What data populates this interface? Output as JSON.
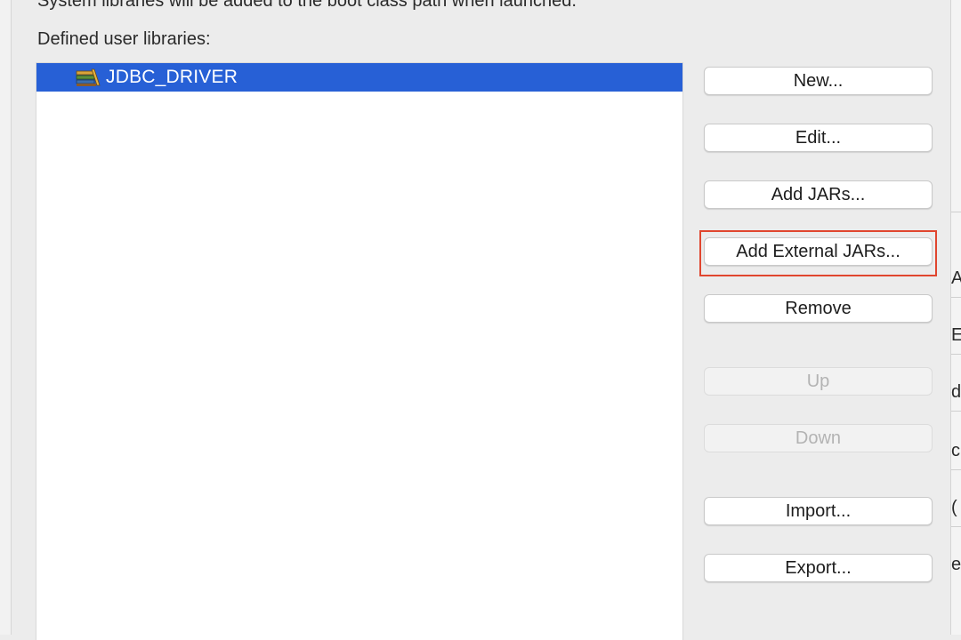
{
  "description": "System libraries will be added to the boot class path when launched.",
  "section_label": "Defined user libraries:",
  "libraries": [
    {
      "name": "JDBC_DRIVER",
      "icon": "library-icon",
      "selected": true
    }
  ],
  "buttons": {
    "new": "New...",
    "edit": "Edit...",
    "add_jars": "Add JARs...",
    "add_external_jars": "Add External JARs...",
    "remove": "Remove",
    "up": "Up",
    "down": "Down",
    "import": "Import...",
    "export": "Export..."
  },
  "colors": {
    "selection": "#2760d6",
    "highlight": "#e0462f"
  },
  "background_window_fragments": [
    "A",
    "E",
    "d",
    "c",
    "(",
    "e"
  ]
}
